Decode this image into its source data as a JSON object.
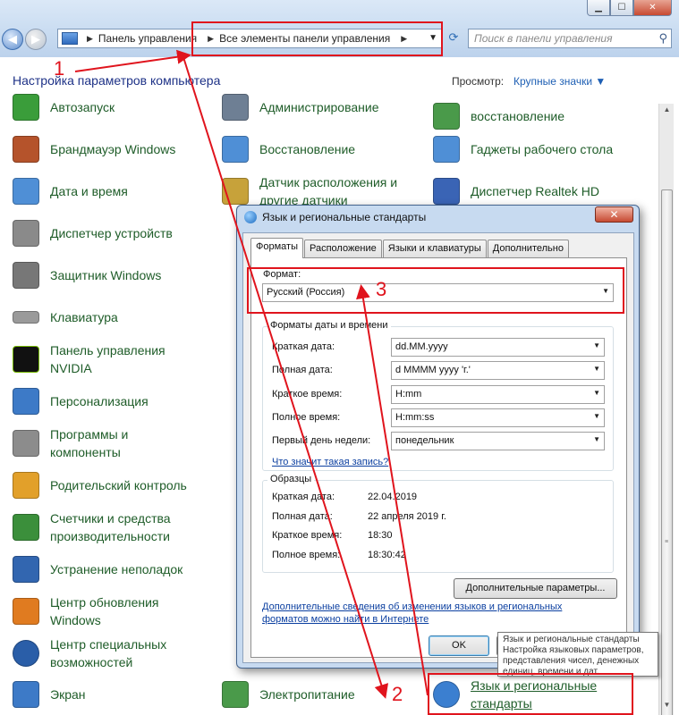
{
  "window": {
    "min": "▁",
    "max": "☐",
    "close": "✕"
  },
  "address": {
    "back": "◀",
    "forward": "▶",
    "crumbs": [
      "Панель управления",
      "Все элементы панели управления"
    ],
    "separator": "▶",
    "dropdown": "▼",
    "refresh": "⟳"
  },
  "search": {
    "placeholder": "Поиск в панели управления",
    "icon": "search-icon"
  },
  "header": {
    "title": "Настройка параметров компьютера",
    "view_label": "Просмотр:",
    "view_value": "Крупные значки ▼"
  },
  "items": [
    {
      "label": "Автозапуск",
      "icon": "autoplay-icon",
      "color": "#3a9d3a"
    },
    {
      "label": "Брандмауэр Windows",
      "icon": "firewall-icon",
      "color": "#b5532b"
    },
    {
      "label": "Дата и время",
      "icon": "clock-icon",
      "color": "#4f8fd6"
    },
    {
      "label": "Диспетчер устройств",
      "icon": "device-manager-icon",
      "color": "#8a8a8a"
    },
    {
      "label": "Защитник Windows",
      "icon": "defender-icon",
      "color": "#777777"
    },
    {
      "label": "Клавиатура",
      "icon": "keyboard-icon",
      "color": "#9a9a9a"
    },
    {
      "label": "Панель управления NVIDIA",
      "icon": "nvidia-icon",
      "color": "#76b900"
    },
    {
      "label": "Персонализация",
      "icon": "personalization-icon",
      "color": "#3d7ac7"
    },
    {
      "label": "Программы и компоненты",
      "icon": "programs-icon",
      "color": "#8c8c8c"
    },
    {
      "label": "Родительский контроль",
      "icon": "parental-control-icon",
      "color": "#e2a02a"
    },
    {
      "label": "Счетчики и средства производительности",
      "icon": "performance-icon",
      "color": "#3b8f3b"
    },
    {
      "label": "Устранение неполадок",
      "icon": "troubleshoot-icon",
      "color": "#3266b0"
    },
    {
      "label": "Центр обновления Windows",
      "icon": "windows-update-icon",
      "color": "#e07b20"
    },
    {
      "label": "Центр специальных возможностей",
      "icon": "accessibility-icon",
      "color": "#2a5ea8"
    },
    {
      "label": "Экран",
      "icon": "display-icon",
      "color": "#3d7ac7"
    },
    {
      "label": "Администрирование",
      "icon": "admin-tools-icon",
      "color": "#6e7f94"
    },
    {
      "label": "Восстановление",
      "icon": "recovery-icon",
      "color": "#4f8fd6"
    },
    {
      "label": "Датчик расположения и другие датчики",
      "icon": "location-sensor-icon",
      "color": "#c7a23a"
    },
    {
      "label": "Электропитание",
      "icon": "power-icon",
      "color": "#4a9a4a"
    },
    {
      "label": "восстановление",
      "icon": "backup-restore-icon",
      "color": "#4a9a4a"
    },
    {
      "label": "Гаджеты рабочего стола",
      "icon": "gadgets-icon",
      "color": "#4f8fd6"
    },
    {
      "label": "Диспетчер Realtek HD",
      "icon": "realtek-icon",
      "color": "#3a64b5"
    },
    {
      "label": "Язык и региональные стандарты",
      "icon": "region-language-icon",
      "color": "#3b7fd0"
    }
  ],
  "dialog": {
    "title": "Язык и региональные стандарты",
    "close": "✕",
    "tabs": [
      "Форматы",
      "Расположение",
      "Языки и клавиатуры",
      "Дополнительно"
    ],
    "format_label": "Формат:",
    "format_value": "Русский (Россия)",
    "group_datetime": "Форматы даты и времени",
    "rows": [
      {
        "label": "Краткая дата:",
        "value": "dd.MM.yyyy"
      },
      {
        "label": "Полная дата:",
        "value": "d MMMM yyyy 'г.'"
      },
      {
        "label": "Краткое время:",
        "value": "H:mm"
      },
      {
        "label": "Полное время:",
        "value": "H:mm:ss"
      },
      {
        "label": "Первый день недели:",
        "value": "понедельник"
      }
    ],
    "meaning_link": "Что значит такая запись?",
    "group_samples": "Образцы",
    "samples": [
      {
        "label": "Краткая дата:",
        "value": "22.04.2019"
      },
      {
        "label": "Полная дата:",
        "value": "22 апреля 2019 г."
      },
      {
        "label": "Краткое время:",
        "value": "18:30"
      },
      {
        "label": "Полное время:",
        "value": "18:30:42"
      }
    ],
    "extra_button": "Дополнительные параметры...",
    "info_link_1": "Дополнительные сведения об изменении языков и региональных",
    "info_link_2": "форматов можно найти в Интернете",
    "ok": "OK"
  },
  "tooltip": [
    "Язык и региональные стандарты",
    "Настройка языковых параметров,",
    "представления чисел, денежных",
    "единиц, времени и дат."
  ],
  "annotations": {
    "a1": "1",
    "a2": "2",
    "a3": "3"
  },
  "colors": {
    "annotation": "#e0141d",
    "item_text": "#1e5c28",
    "link": "#0b3fa0"
  }
}
